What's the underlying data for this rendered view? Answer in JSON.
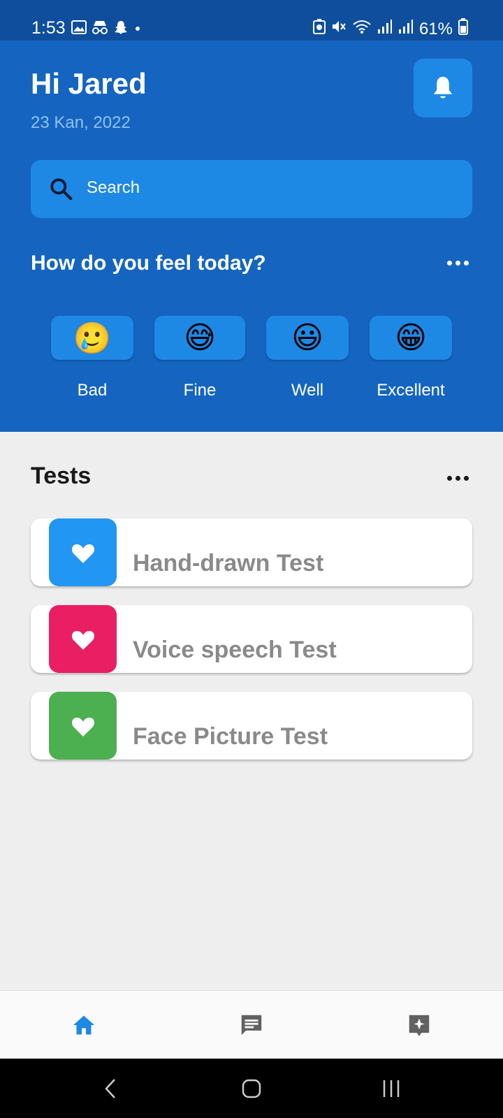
{
  "status_bar": {
    "time": "1:53",
    "battery": "61%"
  },
  "header": {
    "greeting": "Hi Jared",
    "date": "23 Kan, 2022"
  },
  "search": {
    "label": "Search"
  },
  "feel": {
    "title": "How do you feel today?",
    "moods": [
      {
        "label": "Bad",
        "emoji": "🥲"
      },
      {
        "label": "Fine",
        "emoji": "😅"
      },
      {
        "label": "Well",
        "emoji": "😃"
      },
      {
        "label": "Excellent",
        "emoji": "😁"
      }
    ]
  },
  "tests": {
    "title": "Tests",
    "items": [
      {
        "label": "Hand-drawn Test",
        "color": "#2196f3"
      },
      {
        "label": "Voice speech Test",
        "color": "#e91e63"
      },
      {
        "label": "Face Picture Test",
        "color": "#4caf50"
      }
    ]
  },
  "bottom_nav": {
    "active_color": "#1e88e5",
    "inactive_color": "#616161",
    "items": [
      "home-icon",
      "chat-icon",
      "feedback-icon"
    ]
  },
  "colors": {
    "header_bg": "#1565c0",
    "accent": "#1e88e5"
  }
}
